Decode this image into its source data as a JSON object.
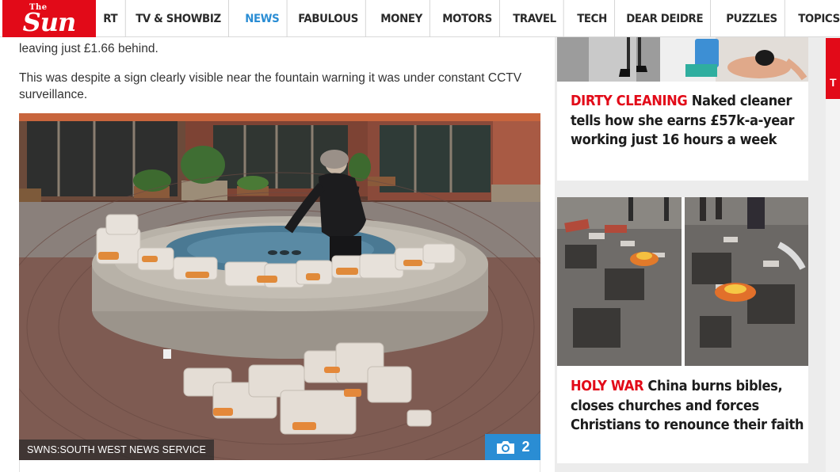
{
  "header": {
    "logo_small": "The",
    "logo_text": "Sun",
    "nav": [
      "RT",
      "TV & SHOWBIZ",
      "NEWS",
      "FABULOUS",
      "MONEY",
      "MOTORS",
      "TRAVEL",
      "TECH",
      "DEAR DEIDRE",
      "PUZZLES",
      "TOPICS A-Z"
    ],
    "active_nav": "NEWS"
  },
  "article": {
    "paragraph_1": "leaving just £1.66 behind.",
    "paragraph_2": "This was despite a sign clearly visible near the fountain warning it was under constant CCTV surveillance.",
    "photo_credit": "SWNS:SOUTH WEST NEWS SERVICE",
    "gallery_count": "2"
  },
  "sidebar": {
    "cards": [
      {
        "kicker": "DIRTY CLEANING",
        "headline": "Naked cleaner tells how she earns £57k-a-year working just 16 hours a week"
      },
      {
        "kicker": "HOLY WAR",
        "headline": "China burns bibles, closes churches and forces Christians to renounce their faith"
      }
    ]
  },
  "edge_tab": "T",
  "colors": {
    "brand_red": "#e20a18",
    "accent_blue": "#2a8dd4"
  },
  "icons": [
    "camera-icon"
  ]
}
